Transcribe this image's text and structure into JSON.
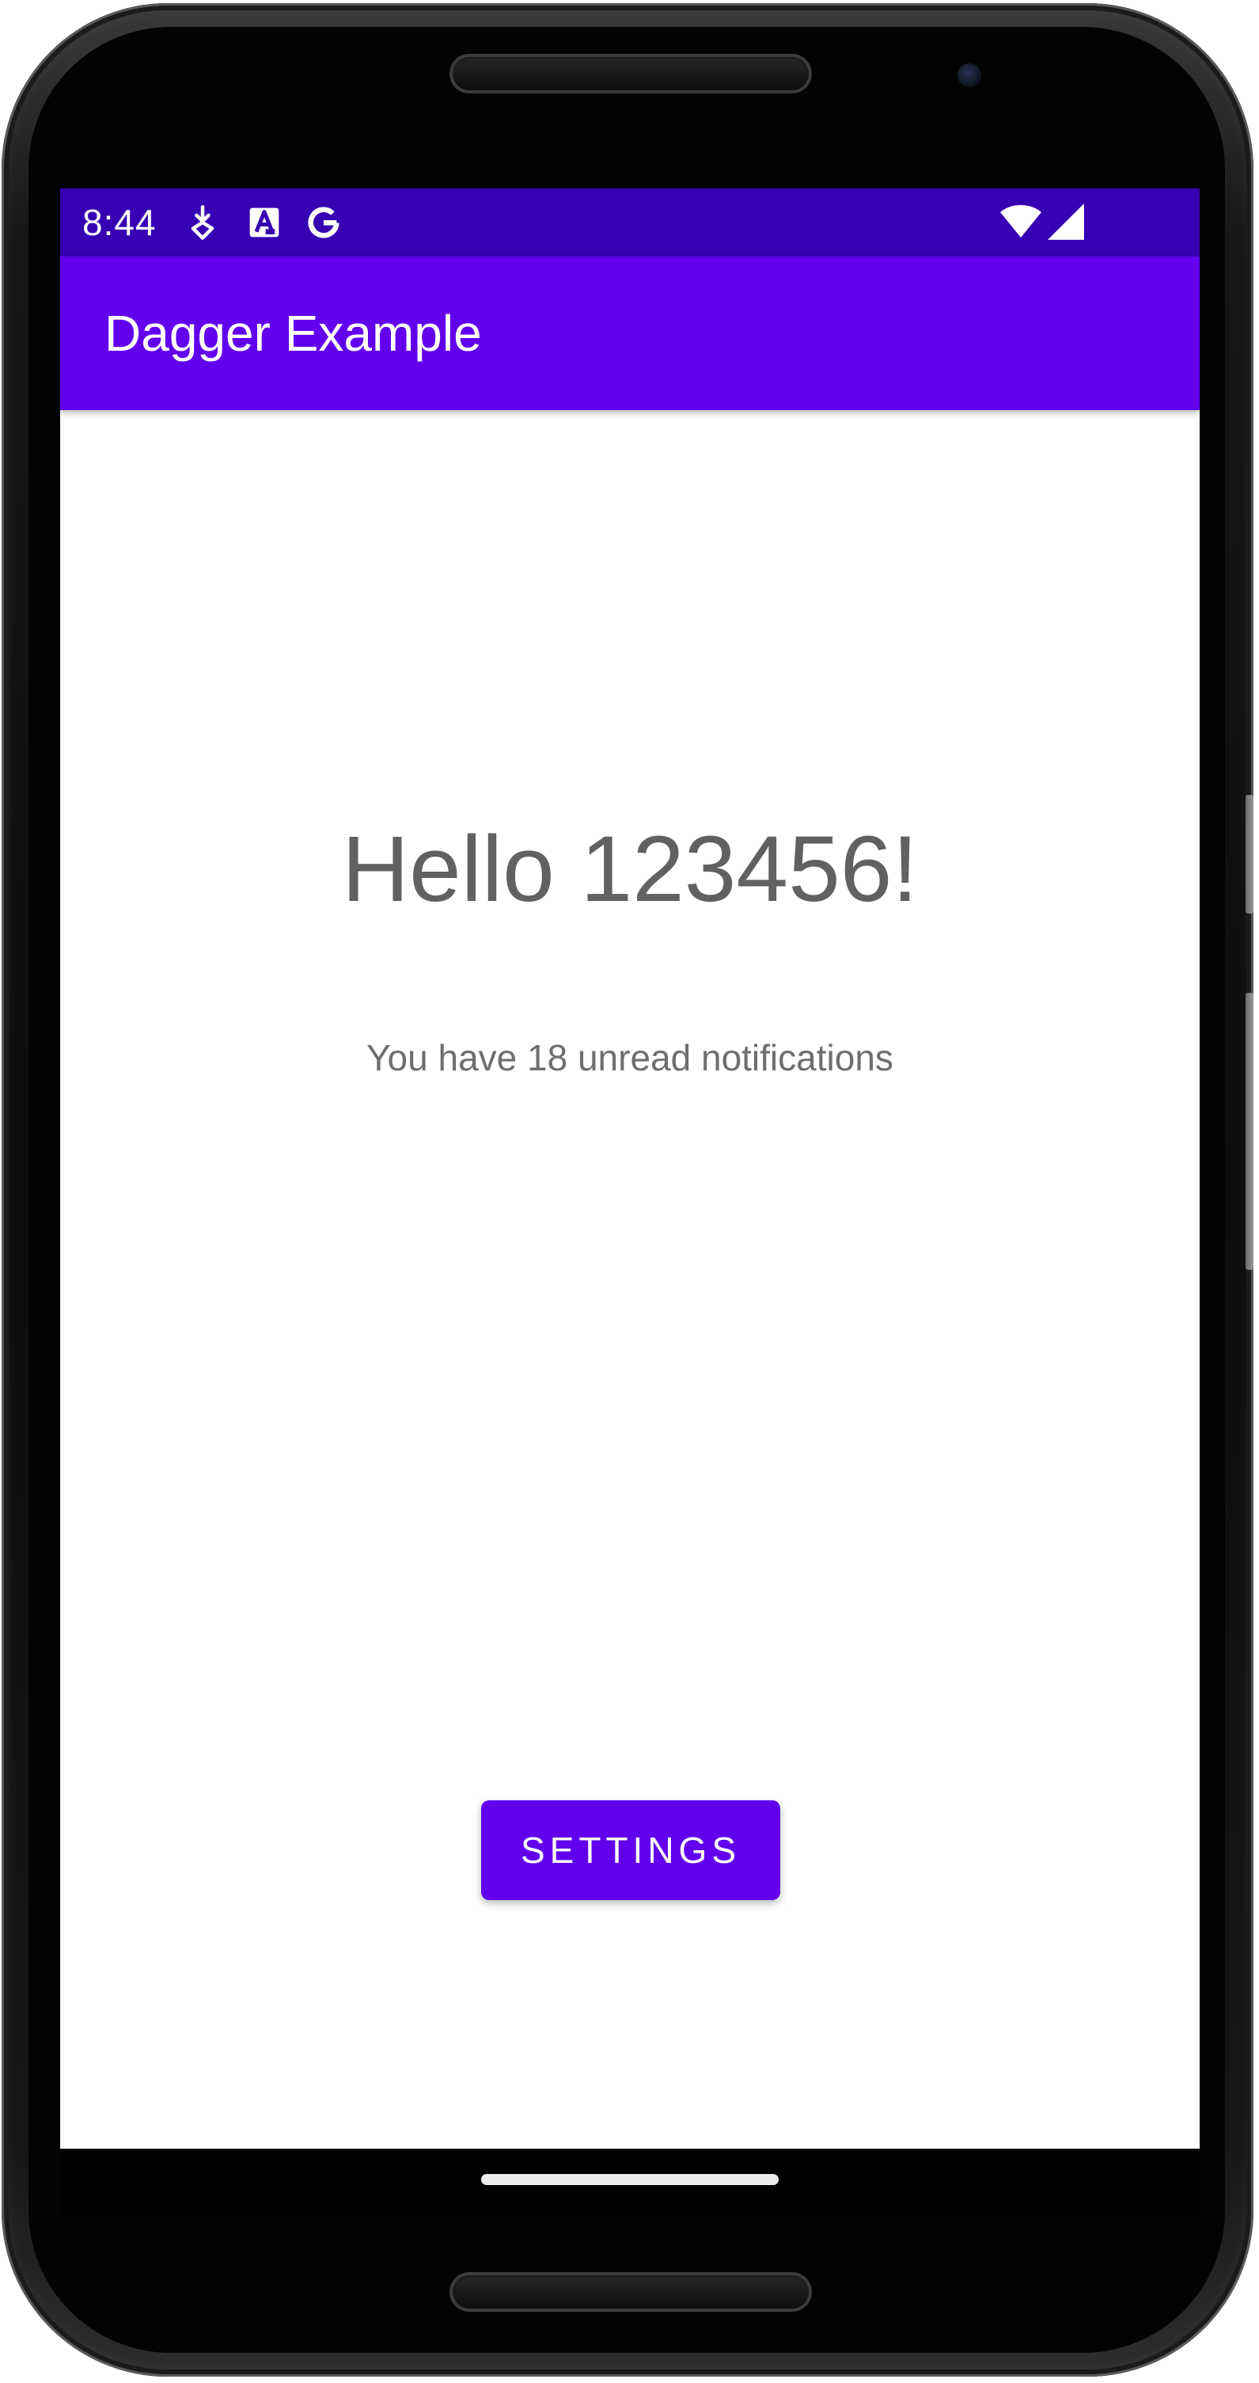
{
  "status_bar": {
    "time": "8:44",
    "icons": [
      "download-notification-icon",
      "accessibility-a-icon",
      "google-g-icon",
      "wifi-icon",
      "cellular-signal-icon"
    ]
  },
  "app_bar": {
    "title": "Dagger Example"
  },
  "main": {
    "greeting": "Hello 123456!",
    "notification_text": "You have 18 unread notifications",
    "settings_button_label": "SETTINGS"
  },
  "colors": {
    "status_bar": "#3700b3",
    "primary": "#6200ee",
    "text_secondary": "#616161",
    "background": "#ffffff"
  }
}
